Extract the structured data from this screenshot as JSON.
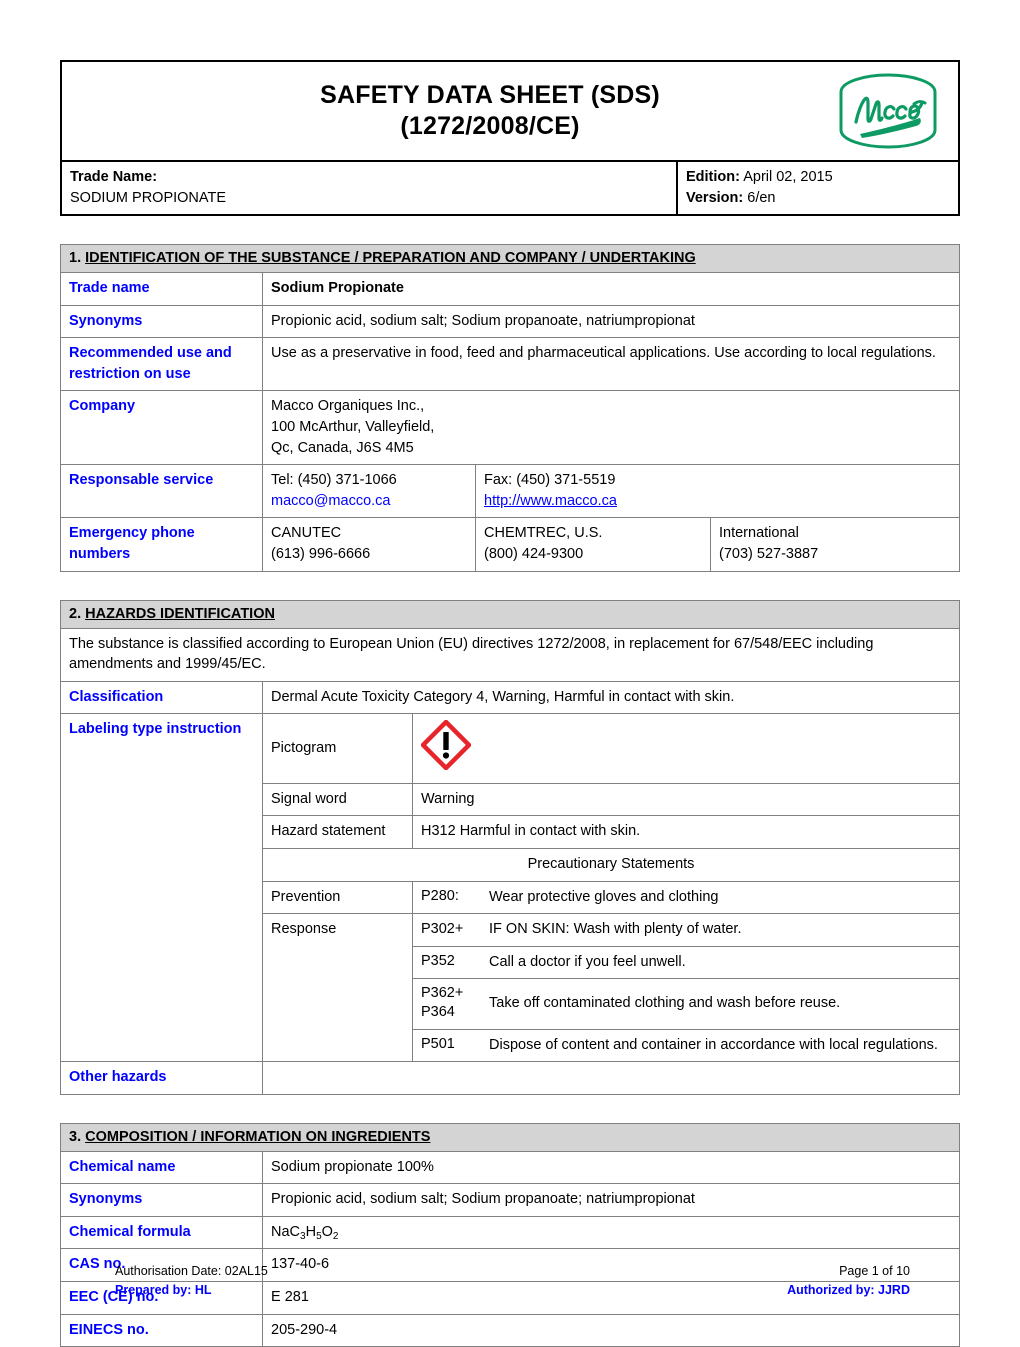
{
  "header": {
    "title_line1": "SAFETY DATA SHEET (SDS)",
    "title_line2": "(1272/2008/CE)",
    "logo_alt": "Macco",
    "trade_name_label": "Trade Name:",
    "trade_name_value": "SODIUM PROPIONATE",
    "edition_label": "Edition:",
    "edition_value": "April 02, 2015",
    "version_label": "Version:",
    "version_value": "6/en"
  },
  "section1": {
    "heading_number": "1.",
    "heading_text": "IDENTIFICATION OF THE SUBSTANCE / PREPARATION AND COMPANY / UNDERTAKING",
    "trade_name_label": "Trade name",
    "trade_name_value": "Sodium Propionate",
    "synonyms_label": "Synonyms",
    "synonyms_value": "Propionic acid, sodium salt; Sodium propanoate, natriumpropionat",
    "recommended_use_label": "Recommended use and restriction on use",
    "recommended_use_value": "Use as a preservative in food, feed and pharmaceutical applications. Use according to local regulations.",
    "company_label": "Company",
    "company_line1": "Macco Organiques Inc.,",
    "company_line2": "100 McArthur, Valleyfield,",
    "company_line3": "Qc, Canada, J6S 4M5",
    "responsable_label": "Responsable service",
    "tel": "Tel: (450) 371-1066",
    "email": "macco@macco.ca",
    "fax": "Fax: (450) 371-5519",
    "website": "http://www.macco.ca",
    "emergency_label": "Emergency phone numbers",
    "emergency": [
      {
        "name": "CANUTEC",
        "phone": "(613) 996-6666"
      },
      {
        "name": "CHEMTREC, U.S.",
        "phone": "(800) 424-9300"
      },
      {
        "name": "International",
        "phone": "(703) 527-3887"
      }
    ]
  },
  "section2": {
    "heading_number": "2.",
    "heading_text": "HAZARDS IDENTIFICATION",
    "intro": "The substance is classified according to European Union (EU) directives 1272/2008, in replacement for 67/548/EEC including amendments and 1999/45/EC.",
    "classification_label": "Classification",
    "classification_value": "Dermal Acute Toxicity Category 4, Warning, Harmful in contact with skin.",
    "labeling_label": "Labeling type instruction",
    "pictogram_label": "Pictogram",
    "pictogram_name": "ghs07-exclamation-mark",
    "signal_word_label": "Signal word",
    "signal_word_value": "Warning",
    "hazard_statement_label": "Hazard statement",
    "hazard_statement_value": "H312 Harmful in contact with skin.",
    "precautionary_header": "Precautionary Statements",
    "prevention_label": "Prevention",
    "prevention_code": "P280:",
    "prevention_text": "Wear protective gloves and clothing",
    "response_label": "Response",
    "response_items": [
      {
        "code": "P302+",
        "code2": "",
        "text": "IF ON SKIN: Wash with plenty of water."
      },
      {
        "code": "P352",
        "code2": "",
        "text": "Call a doctor if you feel unwell."
      },
      {
        "code": "P362+",
        "code2": "P364",
        "text": "Take off contaminated clothing and wash before reuse."
      },
      {
        "code": "P501",
        "code2": "",
        "text": "Dispose of content and container in accordance with local regulations."
      }
    ],
    "other_hazards_label": "Other hazards",
    "other_hazards_value": ""
  },
  "section3": {
    "heading_number": "3.",
    "heading_text": "COMPOSITION / INFORMATION ON INGREDIENTS",
    "rows": [
      {
        "label": "Chemical name",
        "value": "Sodium propionate 100%"
      },
      {
        "label": "Synonyms",
        "value": "Propionic acid, sodium salt; Sodium propanoate; natriumpropionat"
      },
      {
        "label": "Chemical formula",
        "value": "NaC3H5O2"
      },
      {
        "label": "CAS no.",
        "value": "137-40-6"
      },
      {
        "label": "EEC (CE) no.",
        "value": "E 281"
      },
      {
        "label": "EINECS no.",
        "value": "205-290-4"
      }
    ],
    "formula_parts": {
      "p1": "NaC",
      "s1": "3",
      "p2": "H",
      "s2": "5",
      "p3": "O",
      "s3": "2"
    }
  },
  "footer": {
    "authorisation": "Authorisation Date: 02AL15",
    "prepared_by": "Prepared by: HL",
    "page": "Page 1 of 10",
    "authorized_by": "Authorized by: JJRD"
  },
  "colors": {
    "label_blue": "#0000FF",
    "section_header_gray": "#D4D4D4",
    "logo_green": "#0E9A63",
    "pictogram_red": "#E8242B"
  }
}
